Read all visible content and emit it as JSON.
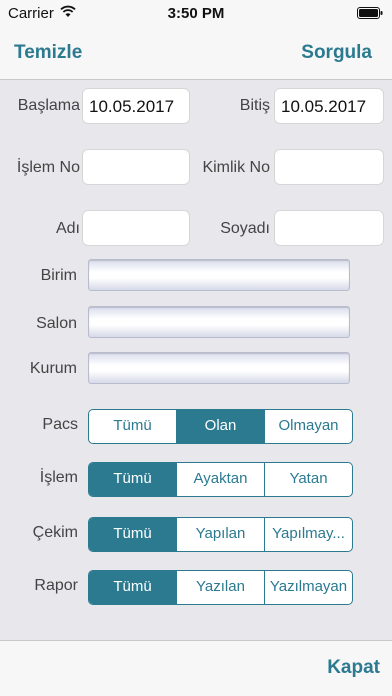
{
  "status_bar": {
    "carrier": "Carrier",
    "time": "3:50 PM"
  },
  "nav": {
    "left_label": "Temizle",
    "right_label": "Sorgula"
  },
  "form": {
    "start_label": "Başlama",
    "start_value": "10.05.2017",
    "end_label": "Bitiş",
    "end_value": "10.05.2017",
    "transaction_label": "İşlem No",
    "transaction_value": "",
    "id_label": "Kimlik No",
    "id_value": "",
    "name_label": "Adı",
    "name_value": "",
    "surname_label": "Soyadı",
    "surname_value": "",
    "unit_label": "Birim",
    "room_label": "Salon",
    "institution_label": "Kurum"
  },
  "segments": {
    "pacs": {
      "label": "Pacs",
      "options": [
        "Tümü",
        "Olan",
        "Olmayan"
      ],
      "selected": 1
    },
    "islem": {
      "label": "İşlem",
      "options": [
        "Tümü",
        "Ayaktan",
        "Yatan"
      ],
      "selected": 0
    },
    "cekim": {
      "label": "Çekim",
      "options": [
        "Tümü",
        "Yapılan",
        "Yapılmay..."
      ],
      "selected": 0
    },
    "rapor": {
      "label": "Rapor",
      "options": [
        "Tümü",
        "Yazılan",
        "Yazılmayan"
      ],
      "selected": 0
    }
  },
  "toolbar": {
    "close_label": "Kapat"
  },
  "colors": {
    "accent": "#2b7a90",
    "background": "#e8e8ec"
  }
}
